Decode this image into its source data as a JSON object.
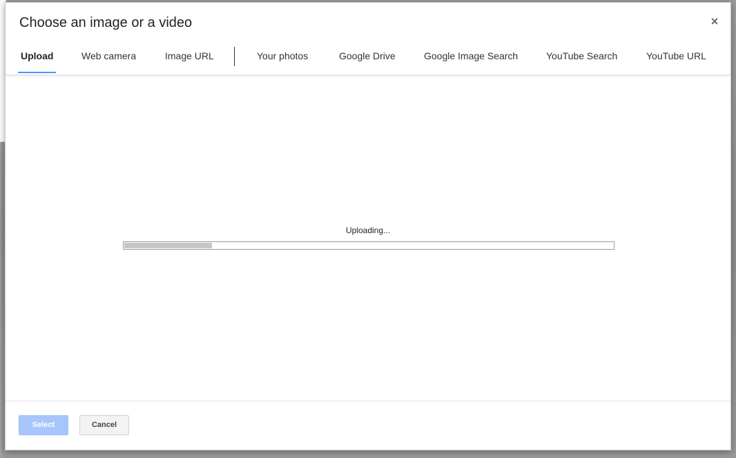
{
  "dialog": {
    "title": "Choose an image or a video",
    "close_label": "×"
  },
  "tabs": [
    {
      "label": "Upload",
      "active": true
    },
    {
      "label": "Web camera",
      "active": false
    },
    {
      "label": "Image URL",
      "active": false
    },
    {
      "label": "Your photos",
      "active": false
    },
    {
      "label": "Google Drive",
      "active": false
    },
    {
      "label": "Google Image Search",
      "active": false
    },
    {
      "label": "YouTube Search",
      "active": false
    },
    {
      "label": "YouTube URL",
      "active": false
    }
  ],
  "upload": {
    "status_text": "Uploading...",
    "progress_percent": 18
  },
  "footer": {
    "select_label": "Select",
    "cancel_label": "Cancel",
    "select_enabled": false
  },
  "colors": {
    "tab_active_underline": "#4d90fe",
    "select_button_disabled": "#a7c6fb",
    "progress_fill": "#c6c6c6"
  }
}
